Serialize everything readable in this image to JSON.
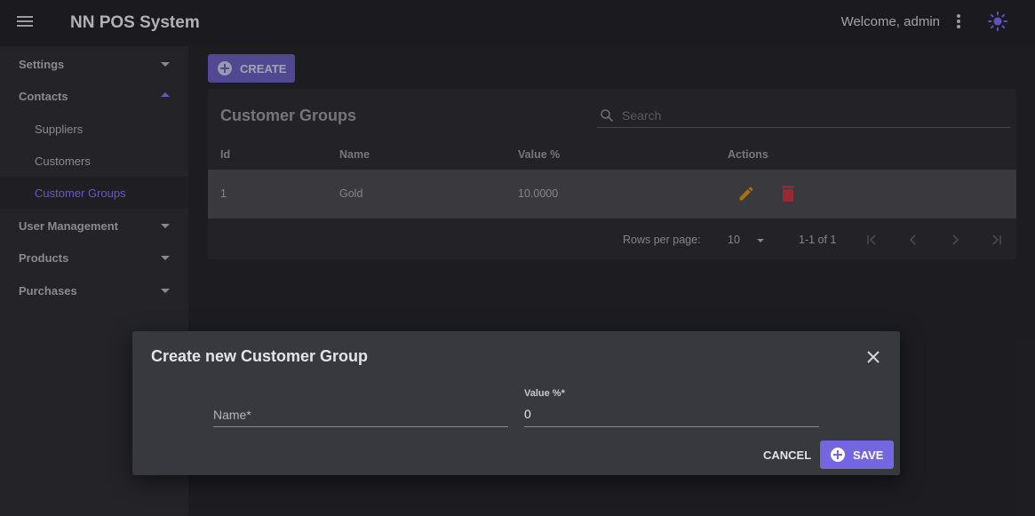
{
  "app": {
    "title": "NN POS System",
    "welcome": "Welcome, admin"
  },
  "sidebar": {
    "items": [
      {
        "label": "Settings",
        "expanded": false
      },
      {
        "label": "Contacts",
        "expanded": true
      },
      {
        "label": "Suppliers"
      },
      {
        "label": "Customers"
      },
      {
        "label": "Customer Groups",
        "active": true
      },
      {
        "label": "User Management",
        "expanded": false
      },
      {
        "label": "Products",
        "expanded": false
      },
      {
        "label": "Purchases",
        "expanded": false
      }
    ]
  },
  "toolbar": {
    "create_label": "CREATE"
  },
  "table": {
    "title": "Customer Groups",
    "search_placeholder": "Search",
    "columns": [
      "Id",
      "Name",
      "Value %",
      "Actions"
    ],
    "rows": [
      {
        "id": "1",
        "name": "Gold",
        "value": "10.0000"
      }
    ],
    "footer": {
      "rows_per_page_label": "Rows per page:",
      "rows_per_page": "10",
      "range": "1-1 of 1"
    }
  },
  "dialog": {
    "title": "Create new Customer Group",
    "name_placeholder": "Name*",
    "value_label": "Value %*",
    "value": "0",
    "cancel_label": "CANCEL",
    "save_label": "SAVE"
  },
  "colors": {
    "accent": "#7466e0",
    "edit": "#c98a12",
    "delete": "#b8343f"
  }
}
